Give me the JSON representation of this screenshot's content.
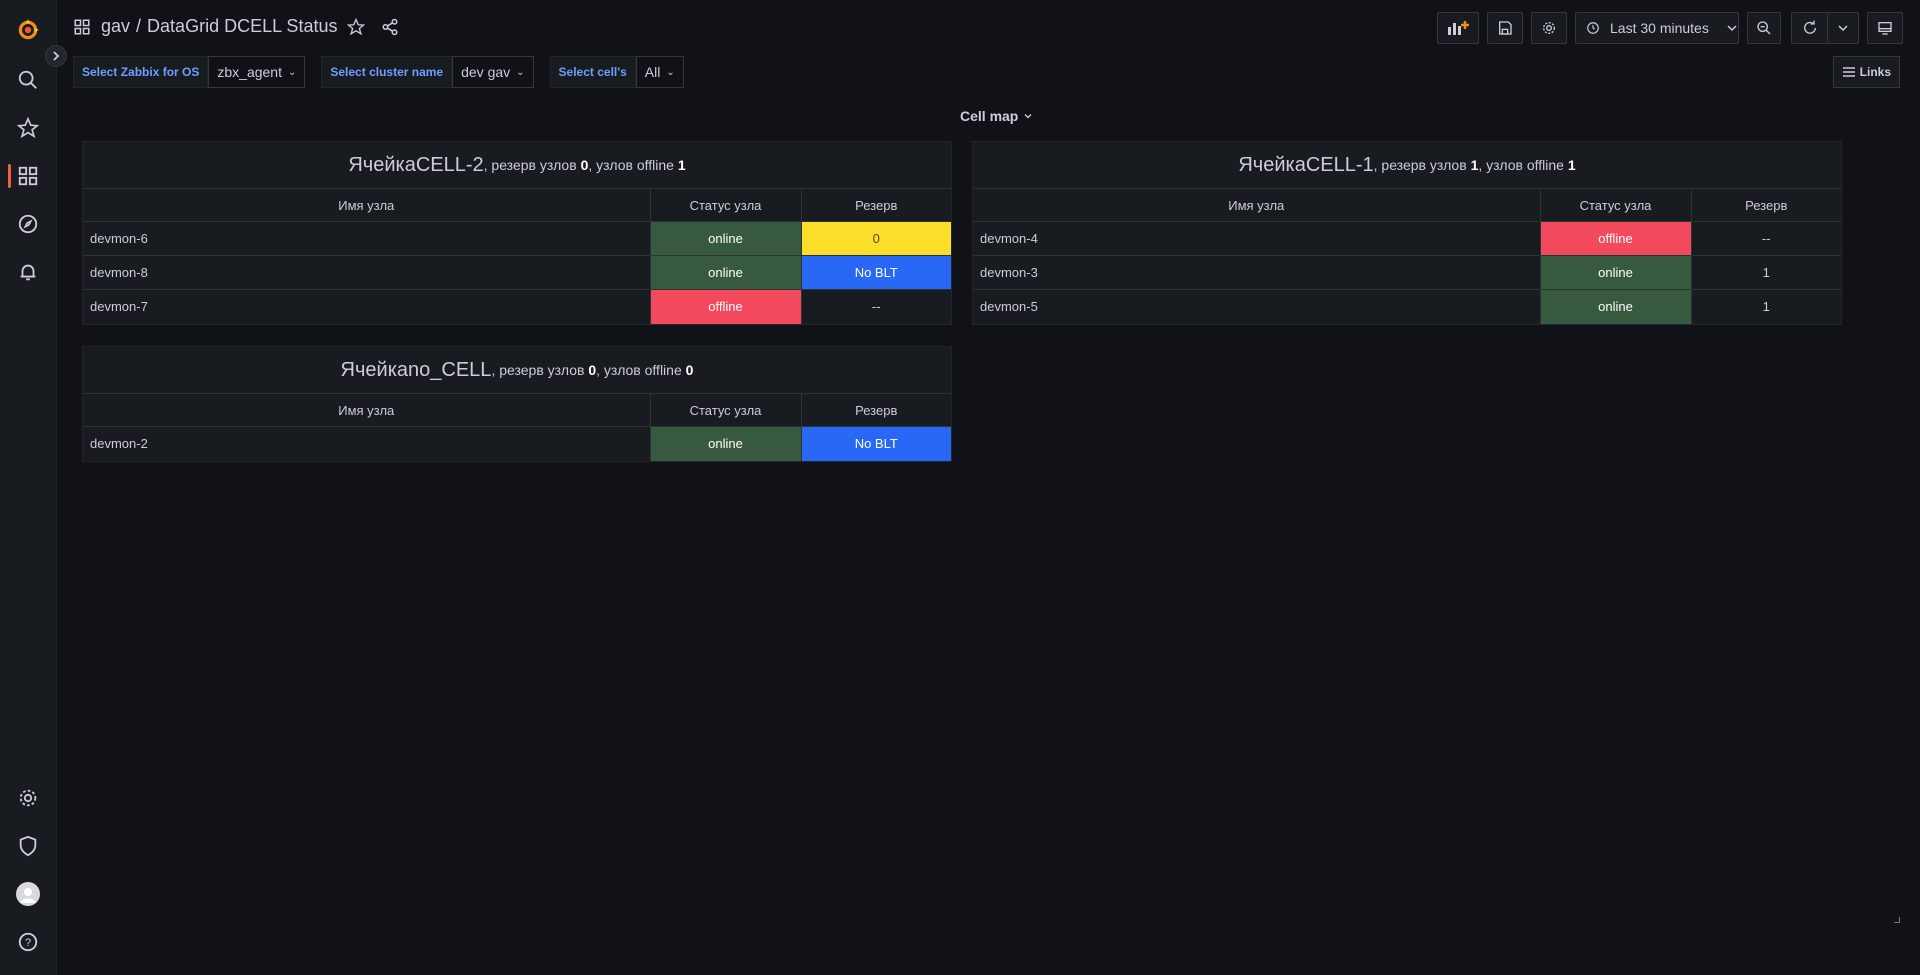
{
  "breadcrumb": {
    "folder": "gav",
    "separator": "/",
    "dashboard": "DataGrid DCELL Status"
  },
  "time_picker": {
    "label": "Last 30 minutes"
  },
  "variables": [
    {
      "label": "Select Zabbix for OS",
      "value": "zbx_agent"
    },
    {
      "label": "Select cluster name",
      "value": "dev gav"
    },
    {
      "label": "Select cell's",
      "value": "All"
    }
  ],
  "links_label": "Links",
  "row_title": "Cell map",
  "columns": {
    "node": "Имя узла",
    "status": "Статус узла",
    "reserve": "Резерв"
  },
  "panels": [
    {
      "cell_prefix": "Ячейка ",
      "cell": "CELL-2",
      "reserve_text": ", резерв узлов ",
      "reserve_count": "0",
      "offline_text": ", узлов offline ",
      "offline_count": "1",
      "rows": [
        {
          "node": "devmon-6",
          "status": "online",
          "reserve": "0"
        },
        {
          "node": "devmon-8",
          "status": "online",
          "reserve": "No BLT"
        },
        {
          "node": "devmon-7",
          "status": "offline",
          "reserve": "--"
        }
      ]
    },
    {
      "cell_prefix": "Ячейка ",
      "cell": "CELL-1",
      "reserve_text": ", резерв узлов ",
      "reserve_count": "1",
      "offline_text": ", узлов offline ",
      "offline_count": "1",
      "rows": [
        {
          "node": "devmon-4",
          "status": "offline",
          "reserve": "--"
        },
        {
          "node": "devmon-3",
          "status": "online",
          "reserve": "1"
        },
        {
          "node": "devmon-5",
          "status": "online",
          "reserve": "1"
        }
      ]
    },
    {
      "cell_prefix": "Ячейка ",
      "cell": "no_CELL",
      "reserve_text": ", резерв узлов ",
      "reserve_count": "0",
      "offline_text": ", узлов offline ",
      "offline_count": "0",
      "rows": [
        {
          "node": "devmon-2",
          "status": "online",
          "reserve": "No BLT"
        }
      ]
    }
  ],
  "colors": {
    "online": "#37593f",
    "offline": "#f2495c",
    "reserve_zero": "#fade2a",
    "no_blt": "#2968f5",
    "accent": "#f55f3e"
  }
}
